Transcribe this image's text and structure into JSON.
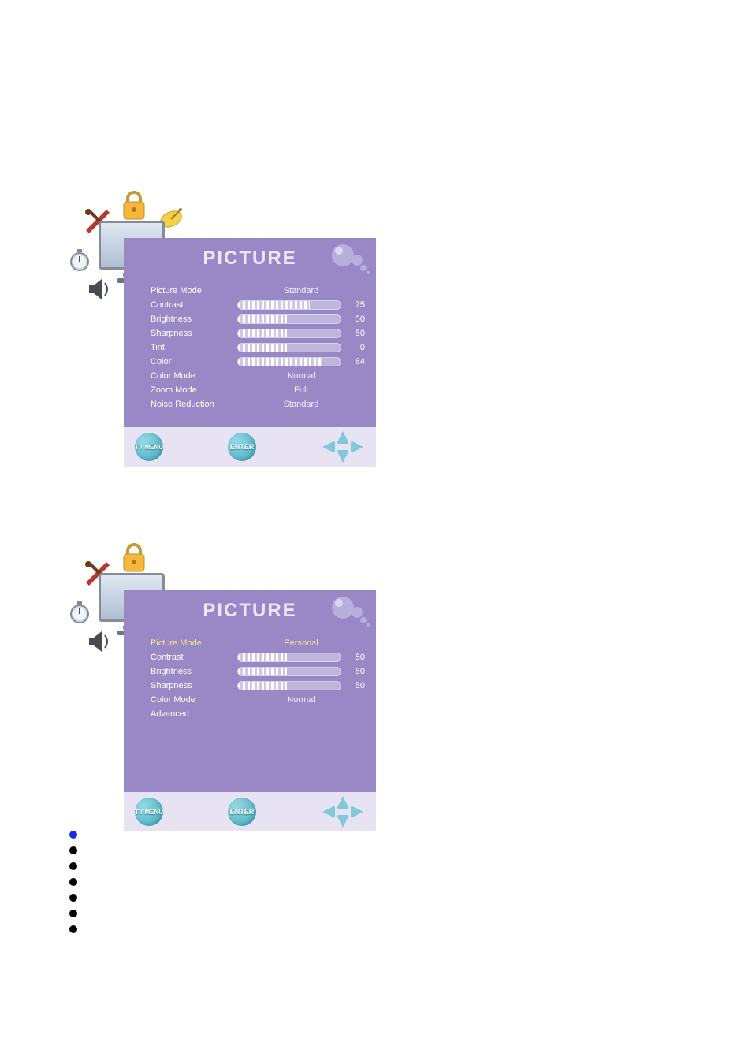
{
  "panel1": {
    "title": "PICTURE",
    "rows": [
      {
        "label": "Picture Mode",
        "type": "text",
        "value": "Standard"
      },
      {
        "label": "Contrast",
        "type": "bar",
        "value": 75,
        "fill": 70
      },
      {
        "label": "Brightness",
        "type": "bar",
        "value": 50,
        "fill": 48
      },
      {
        "label": "Sharpness",
        "type": "bar",
        "value": 50,
        "fill": 48
      },
      {
        "label": "Tint",
        "type": "bar",
        "value": 0,
        "fill": 48
      },
      {
        "label": "Color",
        "type": "bar",
        "value": 84,
        "fill": 82
      },
      {
        "label": "Color Mode",
        "type": "text",
        "value": "Normal"
      },
      {
        "label": "Zoom Mode",
        "type": "text",
        "value": "Full"
      },
      {
        "label": "Noise Reduction",
        "type": "text",
        "value": "Standard"
      }
    ],
    "footer": {
      "menu": "TV\nMENU",
      "enter": "ENTER"
    }
  },
  "panel2": {
    "title": "PICTURE",
    "rows": [
      {
        "label": "Picture Mode",
        "type": "text",
        "value": "Personal",
        "selected": true
      },
      {
        "label": "Contrast",
        "type": "bar",
        "value": 50,
        "fill": 48
      },
      {
        "label": "Brightness",
        "type": "bar",
        "value": 50,
        "fill": 48
      },
      {
        "label": "Sharpness",
        "type": "bar",
        "value": 50,
        "fill": 48
      },
      {
        "label": "Color Mode",
        "type": "text",
        "value": "Normal"
      },
      {
        "label": "Advanced",
        "type": "text",
        "value": ""
      }
    ],
    "footer": {
      "menu": "TV\nMENU",
      "enter": "ENTER"
    }
  },
  "bullets": 7
}
